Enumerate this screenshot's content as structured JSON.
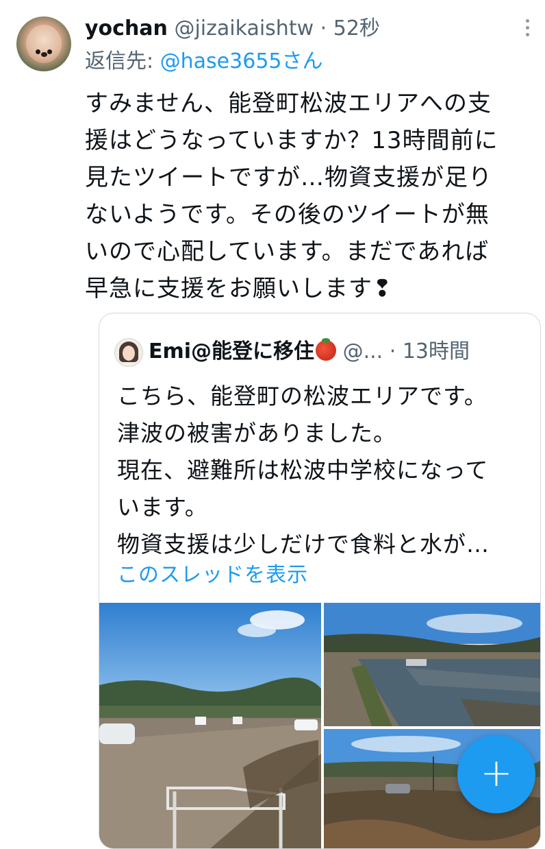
{
  "tweet": {
    "author_name": "yochan",
    "author_handle": "@jizaikaishtw",
    "separator": " · ",
    "time": "52秒",
    "reply_prefix": "返信先: ",
    "reply_to": "@hase3655さん",
    "text_lines": [
      "すみません、能登町松波エリアへの支",
      "援はどうなっていますか？13時間前に",
      "見たツイートですが…物資支援が足り",
      "ないようです。その後のツイートが無",
      "いので心配しています。まだであれば",
      "早急に支援をお願いします❢"
    ]
  },
  "quote": {
    "author_name": "Emi@能登に移住",
    "author_handle": "@...",
    "separator": " · ",
    "time": "13時間",
    "text_lines": [
      "こちら、能登町の松波エリアです。",
      "津波の被害がありました。",
      "現在、避難所は松波中学校になって",
      "います。",
      "物資支援は少しだけで食料と水が…"
    ],
    "show_thread": "このスレッドを表示",
    "photos": [
      "flooded-parking-lot-photo",
      "flooded-field-photo",
      "debris-field-photo"
    ]
  },
  "fab": {
    "label": "+"
  },
  "colors": {
    "accent": "#1d9bf0",
    "text": "#0f1419",
    "secondary": "#536471",
    "border": "#cfd9de"
  }
}
